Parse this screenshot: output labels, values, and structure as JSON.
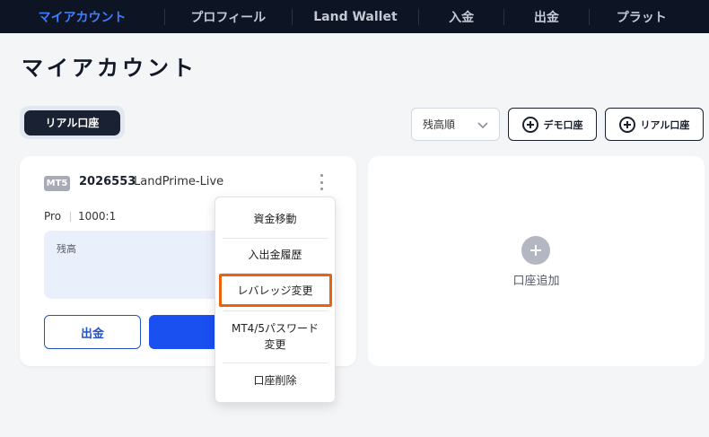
{
  "nav": {
    "items": [
      {
        "label": "マイアカウント",
        "active": true
      },
      {
        "label": "プロフィール",
        "active": false
      },
      {
        "label": "Land Wallet",
        "active": false
      },
      {
        "label": "入金",
        "active": false
      },
      {
        "label": "出金",
        "active": false
      },
      {
        "label": "プラット",
        "active": false
      }
    ]
  },
  "page": {
    "title": "マイアカウント"
  },
  "tabs": {
    "real": "リアル口座"
  },
  "toolbar": {
    "sort_value": "残高順",
    "add_demo": "デモ口座",
    "add_real": "リアル口座"
  },
  "account": {
    "platform": "MT5",
    "number": "2026553",
    "server": "LandPrime-Live",
    "type": "Pro",
    "leverage": "1000:1",
    "balance_label": "残高",
    "withdraw": "出金"
  },
  "add_account": {
    "label": "口座追加"
  },
  "menu": {
    "items": [
      {
        "label": "資金移動"
      },
      {
        "label": "入出金履歴"
      },
      {
        "label": "レバレッジ変更"
      },
      {
        "label": "MT4/5パスワード変更"
      },
      {
        "label": "口座削除"
      }
    ]
  },
  "colors": {
    "nav_bg": "#0d1424",
    "nav_active": "#3d7dff",
    "primary": "#1a4ff0",
    "highlight": "#e8620f"
  }
}
